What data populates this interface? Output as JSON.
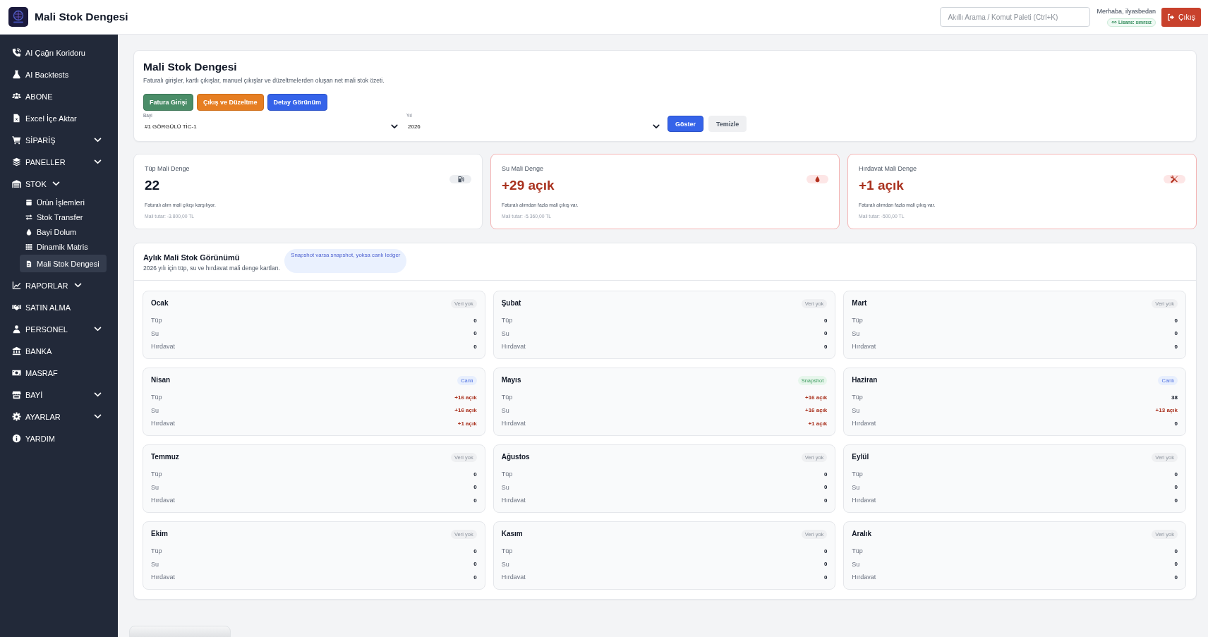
{
  "header": {
    "title": "Mali Stok Dengesi",
    "search": {
      "placeholder": "Akıllı Arama / Komut Paleti (Ctrl+K)"
    },
    "greeting": "Merhaba, ilyasbedan",
    "license": "Lisans: sınırsız",
    "logout_button": "Çıkış"
  },
  "sidebar": {
    "items": [
      {
        "label": "AI Çağrı Koridoru",
        "kind": "link",
        "selected": false
      },
      {
        "label": "AI Backtests",
        "kind": "link",
        "selected": false
      },
      {
        "label": "ABONE",
        "kind": "link",
        "selected": false
      },
      {
        "label": "Excel İçe Aktar",
        "kind": "link",
        "selected": false
      },
      {
        "label": "SİPARİŞ",
        "kind": "group",
        "selected": false
      },
      {
        "label": "PANELLER",
        "kind": "group",
        "selected": false
      },
      {
        "label": "STOK",
        "kind": "group-inline",
        "selected": false,
        "children": [
          {
            "label": "Ürün İşlemleri",
            "selected": false
          },
          {
            "label": "Stok Transfer",
            "selected": false
          },
          {
            "label": "Bayi Dolum",
            "selected": false
          },
          {
            "label": "Dinamik Matris",
            "selected": false
          },
          {
            "label": "Mali Stok Dengesi",
            "selected": true
          }
        ]
      },
      {
        "label": "RAPORLAR",
        "kind": "group-inline",
        "selected": false
      },
      {
        "label": "SATIN ALMA",
        "kind": "link",
        "selected": false
      },
      {
        "label": "PERSONEL",
        "kind": "group",
        "selected": false
      },
      {
        "label": "BANKA",
        "kind": "link",
        "selected": false
      },
      {
        "label": "MASRAF",
        "kind": "link",
        "selected": false
      },
      {
        "label": "BAYİ",
        "kind": "group",
        "selected": false
      },
      {
        "label": "AYARLAR",
        "kind": "group",
        "selected": false
      },
      {
        "label": "YARDIM",
        "kind": "link",
        "selected": false
      }
    ]
  },
  "summary_panel": {
    "title": "Mali Stok Dengesi",
    "subtitle": "Faturalı girişler, kartlı çıkışlar, manuel çıkışlar ve düzeltmelerden oluşan net mali stok özeti.",
    "buttons": [
      {
        "label": "Fatura Girişi",
        "kind": "success"
      },
      {
        "label": "Çıkış ve Düzeltme",
        "kind": "warning"
      },
      {
        "label": "Detay Görünüm",
        "kind": "primary"
      }
    ],
    "filters": [
      {
        "label": "Bayi",
        "value": "#1 GÖRGÜLÜ TİC-1"
      },
      {
        "label": "Yıl",
        "value": "2026"
      }
    ],
    "actions": [
      {
        "label": "Göster",
        "kind": "primary"
      },
      {
        "label": "Temizle",
        "kind": "secondary"
      }
    ]
  },
  "stat_cards": [
    {
      "label": "Tüp Mali Denge",
      "value": "22",
      "deficit": false,
      "description": "Faturalı alım mali çıkışı karşılıyor.",
      "amount": "Mali tutar: -3.800,00 TL"
    },
    {
      "label": "Su Mali Denge",
      "value": "+29 açık",
      "deficit": true,
      "description": "Faturalı alımdan fazla mali çıkış var.",
      "amount": "Mali tutar: -5.360,00 TL"
    },
    {
      "label": "Hırdavat Mali Denge",
      "value": "+1 açık",
      "deficit": true,
      "description": "Faturalı alımdan fazla mali çıkış var.",
      "amount": "Mali tutar: -500,00 TL"
    }
  ],
  "monthly": {
    "title": "Aylık Mali Stok Görünümü",
    "subtitle": "2026 yılı için tüp, su ve hırdavat mali denge kartları.",
    "note": "Snapshot varsa snapshot, yoksa canlı ledger",
    "months": [
      {
        "name": "Ocak",
        "badge": {
          "label": "Veri yok",
          "kind": "no-data"
        },
        "rows": [
          {
            "label": "Tüp",
            "value": "0",
            "deficit": false
          },
          {
            "label": "Su",
            "value": "0",
            "deficit": false
          },
          {
            "label": "Hırdavat",
            "value": "0",
            "deficit": false
          }
        ]
      },
      {
        "name": "Şubat",
        "badge": {
          "label": "Veri yok",
          "kind": "no-data"
        },
        "rows": [
          {
            "label": "Tüp",
            "value": "0",
            "deficit": false
          },
          {
            "label": "Su",
            "value": "0",
            "deficit": false
          },
          {
            "label": "Hırdavat",
            "value": "0",
            "deficit": false
          }
        ]
      },
      {
        "name": "Mart",
        "badge": {
          "label": "Veri yok",
          "kind": "no-data"
        },
        "rows": [
          {
            "label": "Tüp",
            "value": "0",
            "deficit": false
          },
          {
            "label": "Su",
            "value": "0",
            "deficit": false
          },
          {
            "label": "Hırdavat",
            "value": "0",
            "deficit": false
          }
        ]
      },
      {
        "name": "Nisan",
        "badge": {
          "label": "Canlı",
          "kind": "live"
        },
        "rows": [
          {
            "label": "Tüp",
            "value": "+16 açık",
            "deficit": true
          },
          {
            "label": "Su",
            "value": "+16 açık",
            "deficit": true
          },
          {
            "label": "Hırdavat",
            "value": "+1 açık",
            "deficit": true
          }
        ]
      },
      {
        "name": "Mayıs",
        "badge": {
          "label": "Snapshot",
          "kind": "snapshot"
        },
        "rows": [
          {
            "label": "Tüp",
            "value": "+16 açık",
            "deficit": true
          },
          {
            "label": "Su",
            "value": "+16 açık",
            "deficit": true
          },
          {
            "label": "Hırdavat",
            "value": "+1 açık",
            "deficit": true
          }
        ]
      },
      {
        "name": "Haziran",
        "badge": {
          "label": "Canlı",
          "kind": "live"
        },
        "rows": [
          {
            "label": "Tüp",
            "value": "38",
            "deficit": false
          },
          {
            "label": "Su",
            "value": "+13 açık",
            "deficit": true
          },
          {
            "label": "Hırdavat",
            "value": "0",
            "deficit": false
          }
        ]
      },
      {
        "name": "Temmuz",
        "badge": {
          "label": "Veri yok",
          "kind": "no-data"
        },
        "rows": [
          {
            "label": "Tüp",
            "value": "0",
            "deficit": false
          },
          {
            "label": "Su",
            "value": "0",
            "deficit": false
          },
          {
            "label": "Hırdavat",
            "value": "0",
            "deficit": false
          }
        ]
      },
      {
        "name": "Ağustos",
        "badge": {
          "label": "Veri yok",
          "kind": "no-data"
        },
        "rows": [
          {
            "label": "Tüp",
            "value": "0",
            "deficit": false
          },
          {
            "label": "Su",
            "value": "0",
            "deficit": false
          },
          {
            "label": "Hırdavat",
            "value": "0",
            "deficit": false
          }
        ]
      },
      {
        "name": "Eylül",
        "badge": {
          "label": "Veri yok",
          "kind": "no-data"
        },
        "rows": [
          {
            "label": "Tüp",
            "value": "0",
            "deficit": false
          },
          {
            "label": "Su",
            "value": "0",
            "deficit": false
          },
          {
            "label": "Hırdavat",
            "value": "0",
            "deficit": false
          }
        ]
      },
      {
        "name": "Ekim",
        "badge": {
          "label": "Veri yok",
          "kind": "no-data"
        },
        "rows": [
          {
            "label": "Tüp",
            "value": "0",
            "deficit": false
          },
          {
            "label": "Su",
            "value": "0",
            "deficit": false
          },
          {
            "label": "Hırdavat",
            "value": "0",
            "deficit": false
          }
        ]
      },
      {
        "name": "Kasım",
        "badge": {
          "label": "Veri yok",
          "kind": "no-data"
        },
        "rows": [
          {
            "label": "Tüp",
            "value": "0",
            "deficit": false
          },
          {
            "label": "Su",
            "value": "0",
            "deficit": false
          },
          {
            "label": "Hırdavat",
            "value": "0",
            "deficit": false
          }
        ]
      },
      {
        "name": "Aralık",
        "badge": {
          "label": "Veri yok",
          "kind": "no-data"
        },
        "rows": [
          {
            "label": "Tüp",
            "value": "0",
            "deficit": false
          },
          {
            "label": "Su",
            "value": "0",
            "deficit": false
          },
          {
            "label": "Hırdavat",
            "value": "0",
            "deficit": false
          }
        ]
      }
    ]
  }
}
